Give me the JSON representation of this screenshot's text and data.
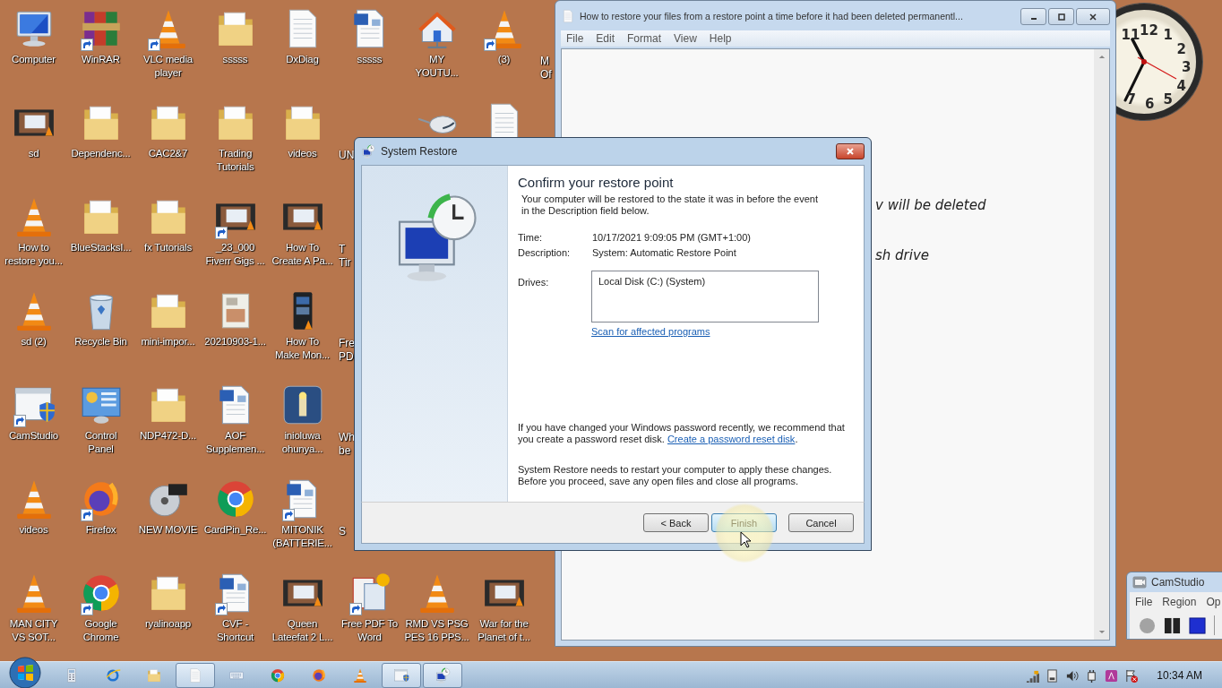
{
  "desktop": {
    "columns": [
      [
        {
          "kind": "monitor",
          "label": "Computer"
        },
        {
          "kind": "video",
          "label": "sd"
        },
        {
          "kind": "cone",
          "label": "How to\nrestore you..."
        },
        {
          "kind": "cone",
          "label": "sd (2)"
        },
        {
          "kind": "shield",
          "label": "CamStudio",
          "shortcut": true
        },
        {
          "kind": "cone",
          "label": "videos"
        },
        {
          "kind": "cone",
          "label": "MAN CITY\nVS SOT..."
        }
      ],
      [
        {
          "kind": "books",
          "label": "WinRAR",
          "shortcut": true
        },
        {
          "kind": "folder",
          "label": "Dependenc..."
        },
        {
          "kind": "folder",
          "label": "BlueStacksI..."
        },
        {
          "kind": "bin",
          "label": "Recycle Bin"
        },
        {
          "kind": "panel",
          "label": "Control\nPanel"
        },
        {
          "kind": "fox",
          "label": "Firefox",
          "shortcut": true
        },
        {
          "kind": "chrome",
          "label": "Google\nChrome",
          "shortcut": true
        }
      ],
      [
        {
          "kind": "cone",
          "label": "VLC media\nplayer",
          "shortcut": true
        },
        {
          "kind": "folder",
          "label": "CAC2&7"
        },
        {
          "kind": "folder",
          "label": "fx Tutorials"
        },
        {
          "kind": "folder",
          "label": "mini-impor..."
        },
        {
          "kind": "folder",
          "label": "NDP472-D..."
        },
        {
          "kind": "disc",
          "label": "NEW MOVIE"
        },
        {
          "kind": "folder",
          "label": "ryalinoapp"
        }
      ],
      [
        {
          "kind": "folder",
          "label": "sssss"
        },
        {
          "kind": "folder",
          "label": "Trading\nTutorials"
        },
        {
          "kind": "video",
          "label": "_23_000\nFiverr Gigs ...",
          "shortcut": true
        },
        {
          "kind": "photo",
          "label": "20210903-1..."
        },
        {
          "kind": "word",
          "label": "AOF\nSupplemen..."
        },
        {
          "kind": "chrome",
          "label": "CardPin_Re..."
        },
        {
          "kind": "word",
          "label": "CVF -\nShortcut",
          "shortcut": true
        }
      ],
      [
        {
          "kind": "document",
          "label": "DxDiag"
        },
        {
          "kind": "folder",
          "label": "videos"
        },
        {
          "kind": "video",
          "label": "How To\nCreate A Pa..."
        },
        {
          "kind": "phone",
          "label": "How To\nMake Mon..."
        },
        {
          "kind": "lighthouse",
          "label": "inioluwa\nohunya..."
        },
        {
          "kind": "word",
          "label": "MITONIK\n(BATTERIE...",
          "shortcut": true
        },
        {
          "kind": "video",
          "label": "Queen\nLateefat 2 L..."
        }
      ],
      [
        {
          "kind": "word",
          "label": "sssss"
        },
        {
          "kind": "partial",
          "label": "UN"
        },
        {
          "kind": "partial",
          "label": "T\nTir"
        },
        {
          "kind": "partial",
          "label": "Fre\nPD"
        },
        {
          "kind": "partial",
          "label": "Wh\nbe"
        },
        {
          "kind": "partial",
          "label": "S"
        },
        {
          "kind": "pdf",
          "label": "Free PDF To\nWord",
          "shortcut": true
        }
      ],
      [
        {
          "kind": "house",
          "label": "MY\nYOUTU..."
        },
        {
          "kind": "mouse"
        },
        null,
        null,
        null,
        null,
        {
          "kind": "cone",
          "label": "RMD VS PSG\nPES 16 PPS..."
        }
      ],
      [
        {
          "kind": "cone",
          "label": "(3)",
          "shortcut": true
        },
        {
          "kind": "document"
        },
        null,
        null,
        null,
        null,
        {
          "kind": "video",
          "label": "War for the\nPlanet of t..."
        }
      ],
      [
        {
          "kind": "partial",
          "label": "M\nOf"
        }
      ]
    ]
  },
  "clock": {
    "numerals": [
      "11",
      "12",
      "1",
      "2",
      "3",
      "4",
      "5",
      "6",
      "7"
    ]
  },
  "notepad": {
    "title": "How to restore your files from a restore point a time before it had been deleted permanentl...",
    "menu": [
      "File",
      "Edit",
      "Format",
      "View",
      "Help"
    ],
    "lines": [
      "v will be deleted",
      "sh drive"
    ]
  },
  "dialog": {
    "title": "System Restore",
    "heading": "Confirm your restore point",
    "intro": "Your computer will be restored to the state it was in before the event in the Description field below.",
    "fields": [
      {
        "label": "Time:",
        "value": "10/17/2021 9:09:05 PM (GMT+1:00)"
      },
      {
        "label": "Description:",
        "value": "System: Automatic Restore Point"
      }
    ],
    "drives_label": "Drives:",
    "drives": [
      "Local Disk (C:) (System)"
    ],
    "scan_link": "Scan for affected programs",
    "password_note": {
      "text": "If you have changed your Windows password recently, we recommend that you create a password reset disk. ",
      "link": "Create a password reset disk",
      "end": "."
    },
    "restart_note": "System Restore needs to restart your computer to apply these changes. Before you proceed, save any open files and close all programs.",
    "buttons": [
      {
        "label": "< Back",
        "highlighted": false
      },
      {
        "label": "Finish",
        "highlighted": true
      },
      {
        "label": "Cancel",
        "highlighted": false
      }
    ]
  },
  "camstudio": {
    "title": "CamStudio",
    "menu": [
      "File",
      "Region",
      "Op"
    ]
  },
  "taskbar": {
    "apps": [
      {
        "kind": "calculator",
        "open": false
      },
      {
        "kind": "ring",
        "open": false
      },
      {
        "kind": "folder",
        "open": false
      },
      {
        "kind": "document",
        "open": true
      },
      {
        "kind": "keyboard",
        "open": false
      },
      {
        "kind": "chrome",
        "open": false
      },
      {
        "kind": "fox",
        "open": false
      },
      {
        "kind": "cone",
        "open": false
      },
      {
        "kind": "shield",
        "open": true
      },
      {
        "kind": "restore",
        "open": true
      }
    ],
    "time": "10:34 AM"
  }
}
